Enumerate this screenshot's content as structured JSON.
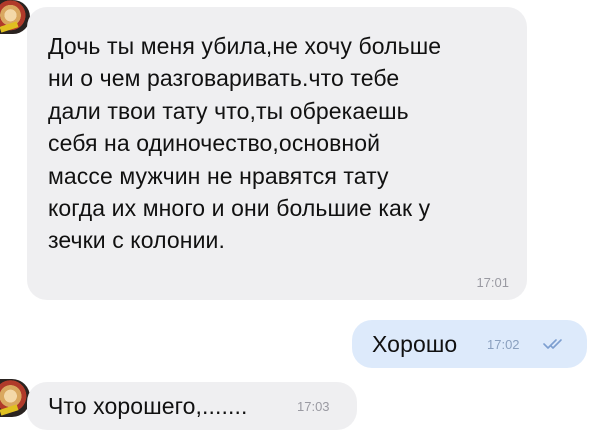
{
  "messages": [
    {
      "direction": "incoming",
      "text": "Дочь ты меня убила,не хочу больше\nни о чем разговаривать.что тебе\nдали твои тату что,ты обрекаешь\nсебя на одиночество,основной\nмассе мужчин не нравятся тату\nкогда их много и они большие как у\nзечки с колонии.",
      "time": "17:01"
    },
    {
      "direction": "outgoing",
      "text": "Хорошо",
      "time": "17:02",
      "status": "read"
    },
    {
      "direction": "incoming",
      "text": "Что хорошего,.......",
      "time": "17:03"
    }
  ],
  "colors": {
    "incoming_bubble": "#efeff1",
    "outgoing_bubble": "#ddeafb",
    "read_ticks": "#7d9fd0"
  },
  "icons": {
    "avatar": "contact-avatar",
    "read_status": "double-check-icon"
  }
}
